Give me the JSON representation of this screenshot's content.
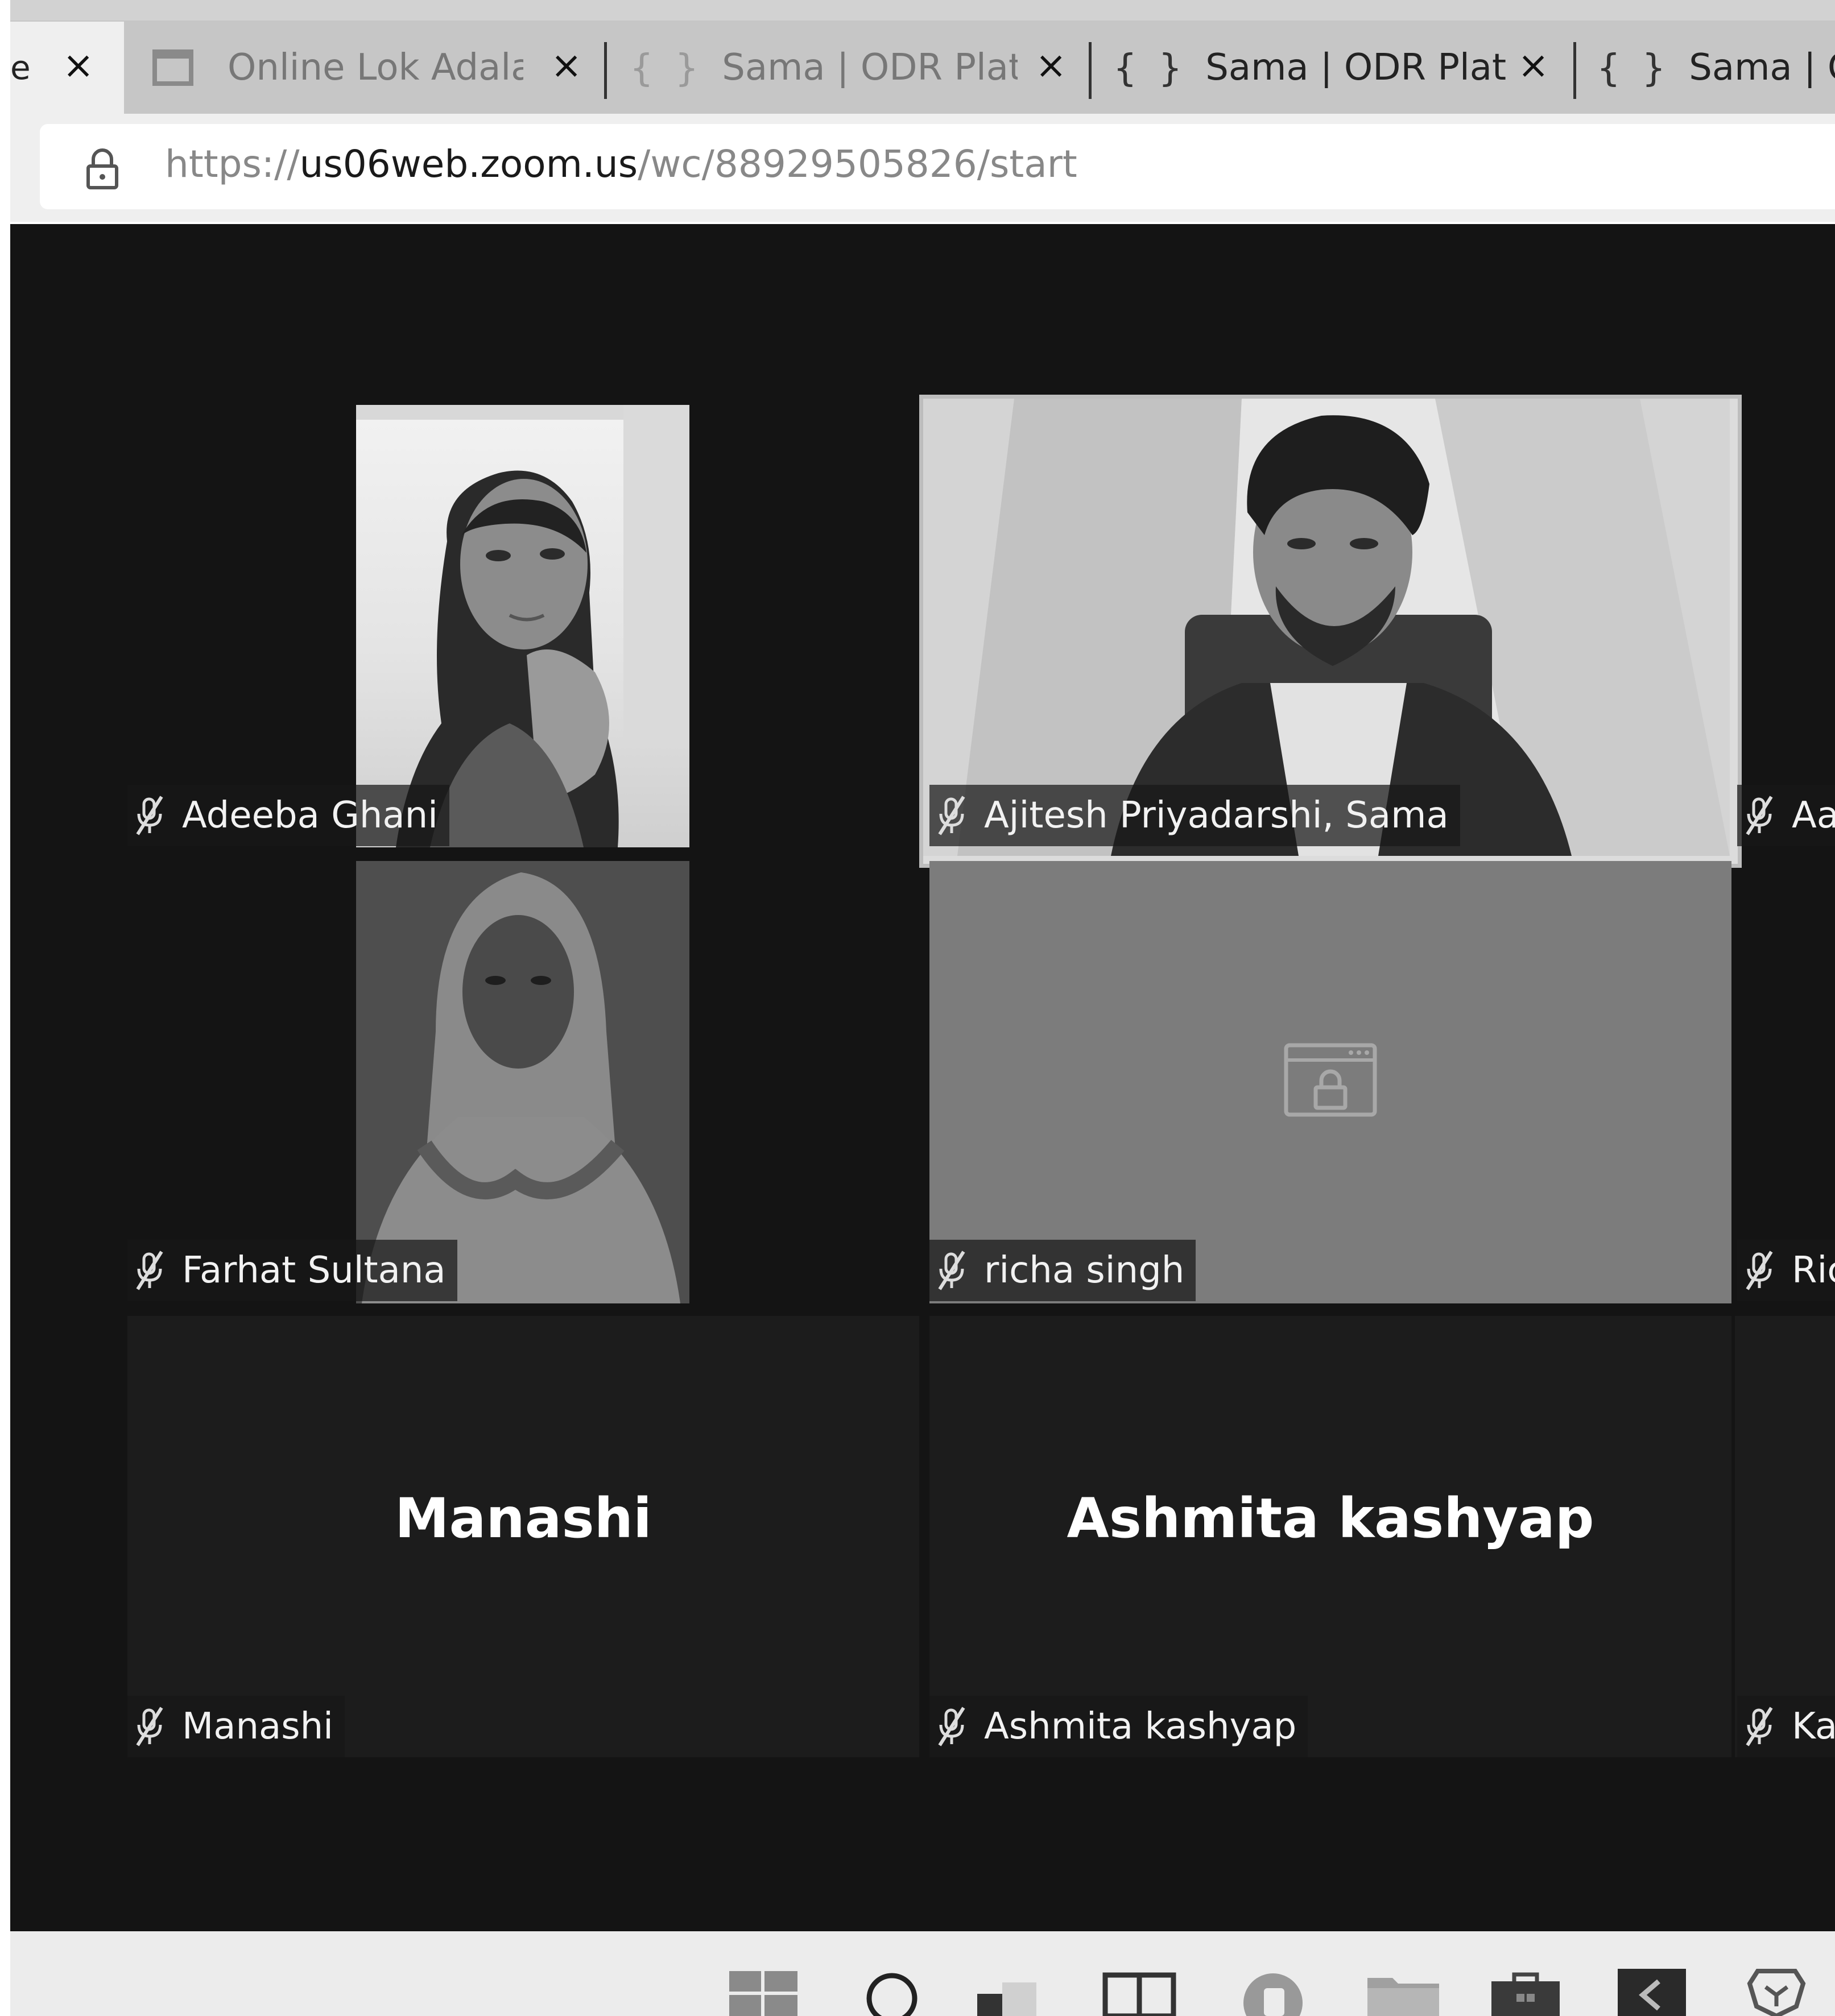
{
  "browser": {
    "tabs": [
      {
        "title": "er:",
        "active": true
      },
      {
        "title": "Online Lok Adalat-",
        "active": false
      },
      {
        "title": "Sama | ODR Platform",
        "active": false
      },
      {
        "title": "Sama | ODR Platform",
        "active": false
      },
      {
        "title": "Sama | OD",
        "active": false
      }
    ],
    "braces": "{ }",
    "close_glyph": "×",
    "url": {
      "scheme": "https://",
      "host": "us06web.zoom.us",
      "path": "/wc/88929505826/start"
    }
  },
  "meeting": {
    "participants": [
      {
        "name": "Adeeba Ghani",
        "label": "Adeeba Ghani",
        "muted": true,
        "video": true
      },
      {
        "name": "Ajitesh Priyadarshi, Sama",
        "label": "Ajitesh Priyadarshi, Sama",
        "muted": true,
        "video": true,
        "active_speaker": true
      },
      {
        "name": "Farhat Sultana",
        "label": "Farhat Sultana",
        "muted": true,
        "video": true
      },
      {
        "name": "richa singh",
        "label": "richa singh",
        "muted": true,
        "video": false,
        "placeholder_icon": "browser-lock-icon"
      },
      {
        "name": "Manashi",
        "label": "Manashi",
        "muted": true,
        "video": false
      },
      {
        "name": "Ashmita kashyap",
        "label": "Ashmita kashyap",
        "muted": true,
        "video": false
      }
    ],
    "offscreen_labels": [
      "Aac",
      "Ric",
      "Kar"
    ]
  },
  "taskbar": {
    "icons": [
      "windows-start-icon",
      "search-icon",
      "task-view-icon",
      "snap-layout-icon",
      "chat-icon",
      "file-explorer-icon",
      "store-icon",
      "app-icon",
      "brave-browser-icon"
    ]
  }
}
